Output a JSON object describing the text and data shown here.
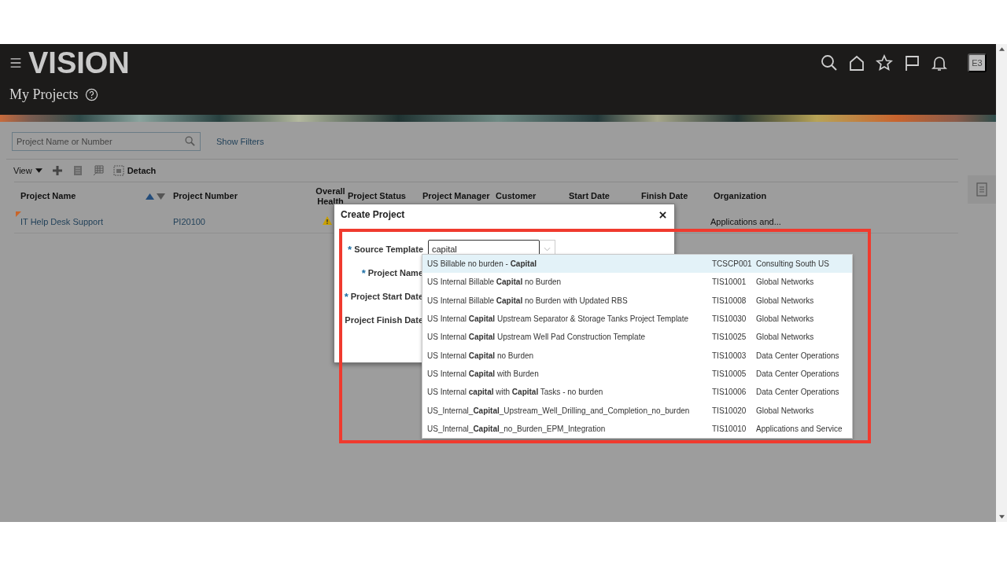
{
  "header": {
    "logo": "VISION",
    "page_title": "My Projects",
    "avatar": "E3"
  },
  "search": {
    "placeholder": "Project Name or Number"
  },
  "show_filters": "Show Filters",
  "toolbar": {
    "view": "View",
    "detach": "Detach"
  },
  "table": {
    "columns": [
      "Project Name",
      "Project Number",
      "Overall Health",
      "Project Status",
      "Project Manager",
      "Customer",
      "Start Date",
      "Finish Date",
      "Organization"
    ],
    "rows": [
      {
        "name": "IT Help Desk Support",
        "number": "PI20100",
        "health_warning": true,
        "organization": "Applications and...",
        "new_indicator": true
      }
    ]
  },
  "dialog": {
    "title": "Create Project",
    "fields": [
      {
        "required_mark": "*",
        "label": "Source Template"
      },
      {
        "required_mark": "*",
        "label": "Project Name"
      },
      {
        "required_mark": "*",
        "label": "Project Start Date"
      },
      {
        "label": "Project Finish Date"
      }
    ],
    "source_value": "capital",
    "options": [
      {
        "name": "US Billable no burden - **Capital**",
        "code": "TCSCP001",
        "organization": "Consulting South US",
        "selected": true
      },
      {
        "name": "US Internal Billable **Capital** no Burden",
        "code": "TIS10001",
        "organization": "Global Networks",
        "selected": false
      },
      {
        "name": "US Internal Billable **Capital** no Burden with Updated RBS",
        "code": "TIS10008",
        "organization": "Global Networks",
        "selected": false
      },
      {
        "name": "US Internal **Capital** Upstream Separator & Storage Tanks Project Template",
        "code": "TIS10030",
        "organization": "Global Networks",
        "selected": false
      },
      {
        "name": "US Internal **Capital** Upstream Well Pad Construction Template",
        "code": "TIS10025",
        "organization": "Global Networks",
        "selected": false
      },
      {
        "name": "US Internal **Capital** no Burden",
        "code": "TIS10003",
        "organization": "Data Center Operations",
        "selected": false
      },
      {
        "name": "US Internal **Capital** with Burden",
        "code": "TIS10005",
        "organization": "Data Center Operations",
        "selected": false
      },
      {
        "name": "US Internal **capital** with **Capital** Tasks - no burden",
        "code": "TIS10006",
        "organization": "Data Center Operations",
        "selected": false
      },
      {
        "name": "US_Internal_**Capital**_Upstream_Well_Drilling_and_Completion_no_burden",
        "code": "TIS10020",
        "organization": "Global Networks",
        "selected": false
      },
      {
        "name": "US_Internal_**Capital**_no_Burden_EPM_Integration",
        "code": "TIS10010",
        "organization": "Applications and Service",
        "selected": false
      }
    ]
  }
}
